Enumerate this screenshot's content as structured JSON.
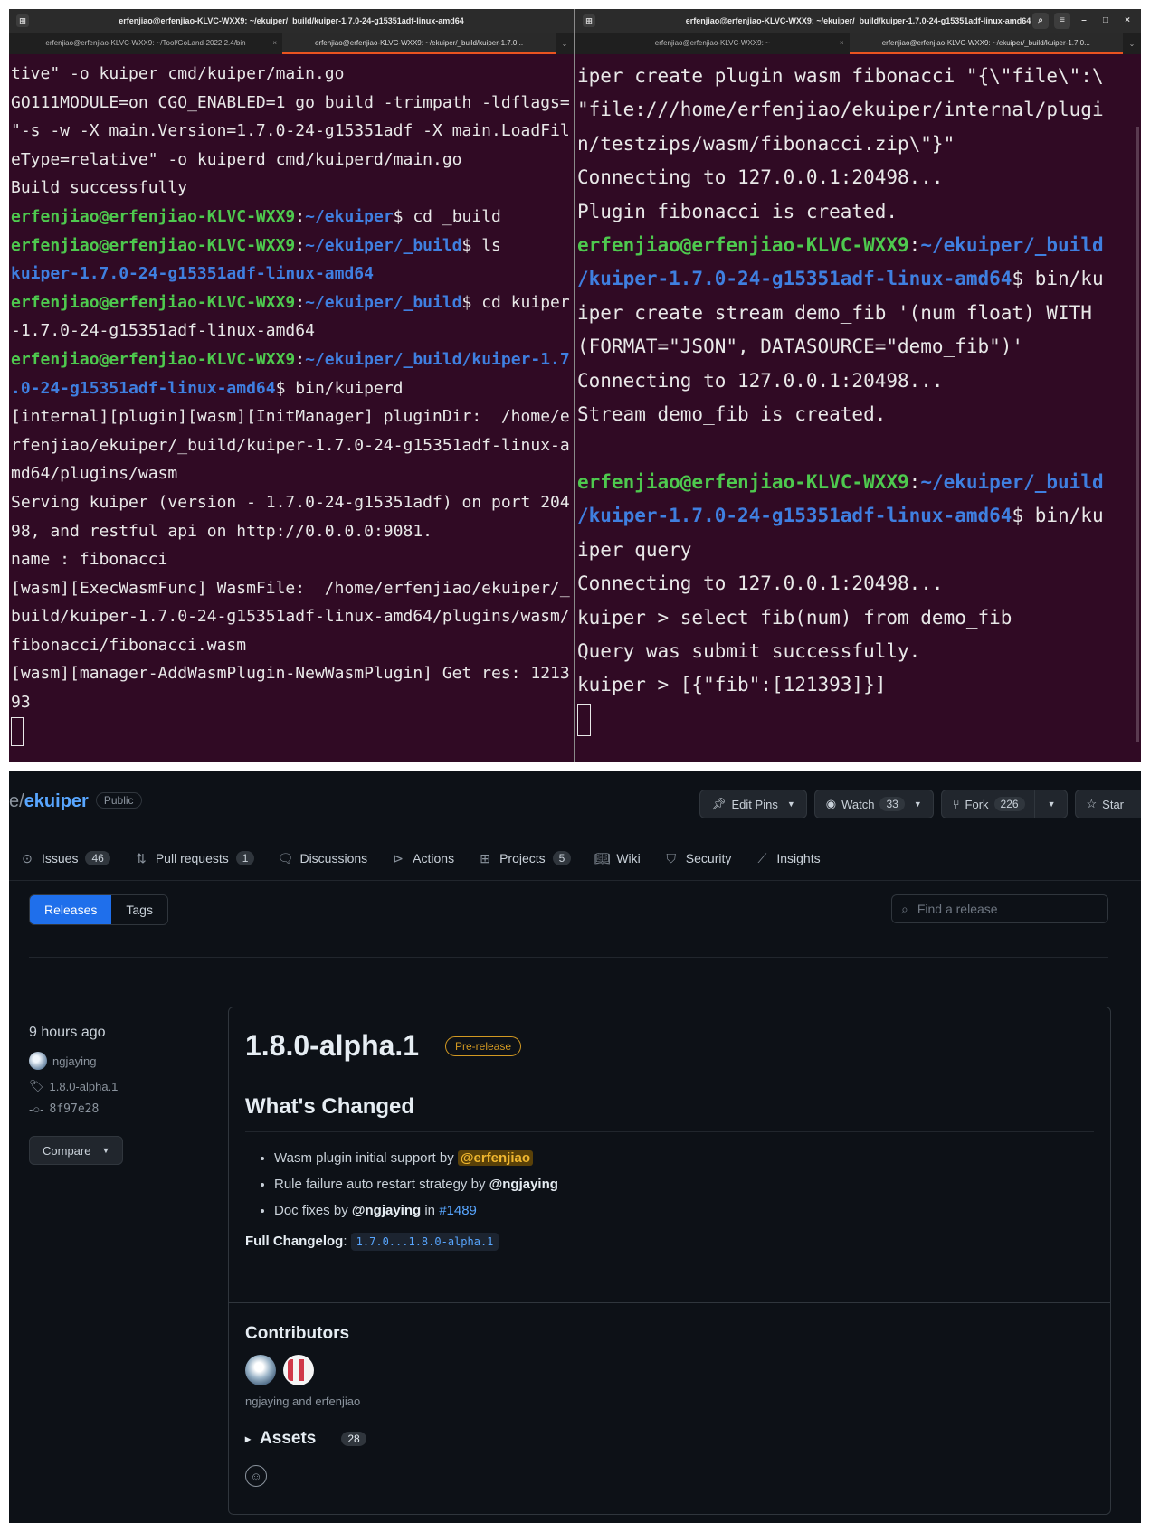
{
  "terminal_left": {
    "title": "erfenjiao@erfenjiao-KLVC-WXX9: ~/ekuiper/_build/kuiper-1.7.0-24-g15351adf-linux-amd64",
    "tabs": [
      "erfenjiao@erfenjiao-KLVC-WXX9: ~/Tool/GoLand-2022.2.4/bin",
      "erfenjiao@erfenjiao-KLVC-WXX9: ~/ekuiper/_build/kuiper-1.7.0..."
    ],
    "prompt_user": "erfenjiao@erfenjiao-KLVC-WXX9",
    "lines": {
      "l1": "tive\" -o kuiper cmd/kuiper/main.go",
      "l2": "GO111MODULE=on CGO_ENABLED=1 go build -trimpath -ldflags=",
      "l3": "\"-s -w -X main.Version=1.7.0-24-g15351adf -X main.LoadFil",
      "l4": "eType=relative\" -o kuiperd cmd/kuiperd/main.go",
      "l5": "Build successfully",
      "p1_path": "~/ekuiper",
      "p1_cmd": "$ cd _build",
      "p2_path": "~/ekuiper/_build",
      "p2_cmd": "$ ls",
      "ls_out": "kuiper-1.7.0-24-g15351adf-linux-amd64",
      "p3_path": "~/ekuiper/_build",
      "p3_cmd": "$ cd kuiper",
      "p3_cont": "-1.7.0-24-g15351adf-linux-amd64",
      "p4_path_a": "~/ekuiper/_build/kuiper-1.7",
      "p4_path_b": ".0-24-g15351adf-linux-amd64",
      "p4_cmd": "$ bin/kuiperd",
      "o1": "[internal][plugin][wasm][InitManager] pluginDir:  /home/e",
      "o2": "rfenjiao/ekuiper/_build/kuiper-1.7.0-24-g15351adf-linux-a",
      "o3": "md64/plugins/wasm",
      "o4": "Serving kuiper (version - 1.7.0-24-g15351adf) on port 204",
      "o5": "98, and restful api on http://0.0.0.0:9081.",
      "o6": "name : fibonacci",
      "o7": "[wasm][ExecWasmFunc] WasmFile:  /home/erfenjiao/ekuiper/_",
      "o8": "build/kuiper-1.7.0-24-g15351adf-linux-amd64/plugins/wasm/",
      "o9": "fibonacci/fibonacci.wasm",
      "o10": "[wasm][manager-AddWasmPlugin-NewWasmPlugin] Get res: 1213",
      "o11": "93"
    }
  },
  "terminal_right": {
    "title": "erfenjiao@erfenjiao-KLVC-WXX9: ~/ekuiper/_build/kuiper-1.7.0-24-g15351adf-linux-amd64",
    "tabs": [
      "erfenjiao@erfenjiao-KLVC-WXX9: ~",
      "erfenjiao@erfenjiao-KLVC-WXX9: ~/ekuiper/_build/kuiper-1.7.0..."
    ],
    "prompt_user": "erfenjiao@erfenjiao-KLVC-WXX9",
    "lines": {
      "r1": "iper create plugin wasm fibonacci \"{\\\"file\\\":\\",
      "r2": "\"file:///home/erfenjiao/ekuiper/internal/plugi",
      "r3": "n/testzips/wasm/fibonacci.zip\\\"}\"",
      "r4": "Connecting to 127.0.0.1:20498...",
      "r5": "Plugin fibonacci is created.",
      "pa_path_a": "~/ekuiper/_build",
      "pa_path_b": "/kuiper-1.7.0-24-g15351adf-linux-amd64",
      "pa_cmd": "$ bin/ku",
      "r6": "iper create stream demo_fib '(num float) WITH",
      "r7": "(FORMAT=\"JSON\", DATASOURCE=\"demo_fib\")'",
      "r8": "Connecting to 127.0.0.1:20498...",
      "r9": "Stream demo_fib is created.",
      "pb_path_a": "~/ekuiper/_build",
      "pb_path_b": "/kuiper-1.7.0-24-g15351adf-linux-amd64",
      "pb_cmd": "$ bin/ku",
      "r10": "iper query",
      "r11": "Connecting to 127.0.0.1:20498...",
      "r12": "kuiper > select fib(num) from demo_fib",
      "r13": "Query was submit successfully.",
      "r14": "kuiper > [{\"fib\":[121393]}]"
    }
  },
  "github": {
    "repo_prefix": "e",
    "repo_sep": "/",
    "repo_name": "ekuiper",
    "visibility": "Public",
    "actions": {
      "edit_pins": "Edit Pins",
      "watch": "Watch",
      "watch_count": "33",
      "fork": "Fork",
      "fork_count": "226",
      "star": "Star"
    },
    "nav": {
      "issues": "Issues",
      "issues_count": "46",
      "pulls": "Pull requests",
      "pulls_count": "1",
      "discussions": "Discussions",
      "actions": "Actions",
      "projects": "Projects",
      "projects_count": "5",
      "wiki": "Wiki",
      "security": "Security",
      "insights": "Insights"
    },
    "tabs": {
      "releases": "Releases",
      "tags": "Tags"
    },
    "search_placeholder": "Find a release",
    "release": {
      "time_ago": "9 hours ago",
      "author": "ngjaying",
      "tag": "1.8.0-alpha.1",
      "commit": "8f97e28",
      "compare": "Compare",
      "version": "1.8.0-alpha.1",
      "badge": "Pre-release",
      "whats_changed": "What's Changed",
      "items": {
        "i1_text": "Wasm plugin initial support by ",
        "i1_user": "@erfenjiao",
        "i2_text": "Rule failure auto restart strategy by ",
        "i2_user": "@ngjaying",
        "i3_text": "Doc fixes by ",
        "i3_user": "@ngjaying",
        "i3_in": " in ",
        "i3_pr": "#1489"
      },
      "changelog_label": "Full Changelog",
      "changelog_sep": ": ",
      "changelog_range": "1.7.0...1.8.0-alpha.1",
      "contributors_title": "Contributors",
      "contributors_names": "ngjaying and erfenjiao",
      "assets_title": "Assets",
      "assets_count": "28"
    }
  }
}
